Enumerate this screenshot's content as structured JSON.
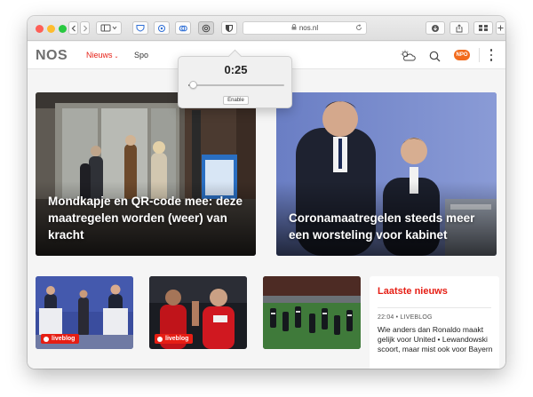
{
  "browser": {
    "url": "nos.nl",
    "lock_icon": "lock-icon",
    "reload_icon": "reload-icon"
  },
  "popover": {
    "time": "0:25",
    "slider_progress": 0.04,
    "enable_label": "Enable"
  },
  "nos": {
    "logo": "NOS",
    "nav": {
      "nieuws": "Nieuws",
      "sport": "Spo"
    },
    "npo_badge": "NPO",
    "accent": "#e61e14"
  },
  "hero": [
    {
      "title": "Mondkapje en QR-code mee: deze maatregelen worden (weer) van kracht"
    },
    {
      "title": "Coronamaatregelen steeds meer een worsteling voor kabinet"
    }
  ],
  "small_cards": [
    {
      "badge": "liveblog"
    },
    {
      "badge": "liveblog"
    },
    {
      "badge": ""
    }
  ],
  "latest_news": {
    "title": "Laatste nieuws",
    "time": "22:04 • LIVEBLOG",
    "text": "Wie anders dan Ronaldo maakt gelijk voor United • Lewandowski scoort, maar mist ook voor Bayern"
  }
}
